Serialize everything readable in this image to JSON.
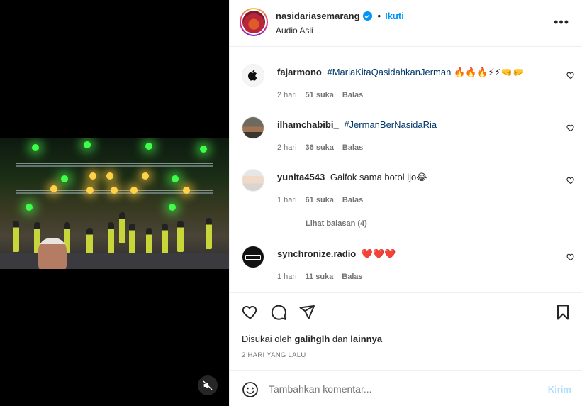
{
  "post": {
    "username": "nasidariasemarang",
    "follow_label": "Ikuti",
    "dot": "•",
    "audio": "Audio Asli",
    "more": "•••"
  },
  "comments": [
    {
      "user": "fajarmono",
      "text": "#MariaKitaQasidahkanJerman",
      "emoji": "🔥🔥🔥⚡⚡🤜🤛",
      "time": "2 hari",
      "likes": "51 suka",
      "reply": "Balas"
    },
    {
      "user": "ilhamchabibi_",
      "text": "#JermanBerNasidaRia",
      "emoji": "",
      "time": "2 hari",
      "likes": "36 suka",
      "reply": "Balas"
    },
    {
      "user": "yunita4543",
      "text": "Galfok sama botol ijo😂",
      "emoji": "",
      "time": "1 hari",
      "likes": "61 suka",
      "reply": "Balas"
    },
    {
      "user": "synchronize.radio",
      "text": "",
      "emoji": "❤️❤️❤️",
      "time": "1 hari",
      "likes": "11 suka",
      "reply": "Balas"
    }
  ],
  "view_replies": "Lihat balasan (4)",
  "liked_by": {
    "prefix": "Disukai oleh",
    "user": "galihglh",
    "conj": "dan",
    "others": "lainnya"
  },
  "date": "2 HARI YANG LALU",
  "add_comment": {
    "placeholder": "Tambahkan komentar...",
    "post_label": "Kirim"
  }
}
